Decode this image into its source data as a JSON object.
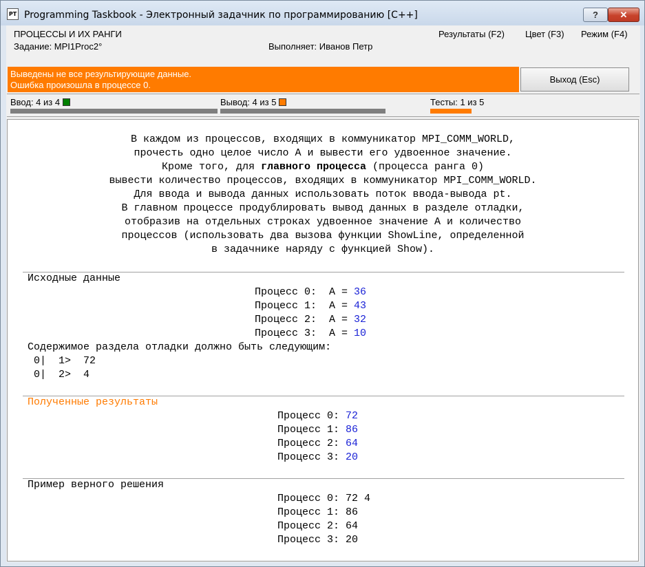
{
  "window": {
    "title": "Programming Taskbook - Электронный задачник по программированию [C++]",
    "app_icon_text": "PT",
    "help_label": "?",
    "close_label": "✕"
  },
  "header": {
    "group": "ПРОЦЕССЫ И ИХ РАНГИ",
    "task": "Задание: MPI1Proc2°",
    "performer": "Выполняет: Иванов Петр",
    "menu": {
      "results": "Результаты (F2)",
      "color": "Цвет (F3)",
      "mode": "Режим (F4)"
    }
  },
  "error": {
    "line1": "Выведены не все результирующие данные.",
    "line2": "Ошибка произошла в процессе 0."
  },
  "exit_button": "Выход (Esc)",
  "stats": {
    "input": "Ввод: 4 из 4",
    "output": "Вывод: 4 из 5",
    "tests": "Тесты: 1 из 5",
    "input_color": "#008000",
    "output_color": "#ff7b00"
  },
  "task": {
    "l1": "В каждом из процессов, входящих в коммуникатор MPI_COMM_WORLD,",
    "l2": "прочесть одно целое число A и вывести его удвоенное значение.",
    "l3_pre": "Кроме того, для ",
    "l3_bold": "главного процесса",
    "l3_post": " (процесса ранга 0)",
    "l4": "вывести количество процессов, входящих в коммуникатор MPI_COMM_WORLD.",
    "l5": "Для ввода и вывода данных использовать поток ввода-вывода pt.",
    "l6": "В главном процессе продублировать вывод данных в разделе отладки,",
    "l7": "отобразив на отдельных строках удвоенное значение A и количество",
    "l8": "процессов (использовать два вызова функции ShowLine, определенной",
    "l9": "в задачнике наряду с функцией Show)."
  },
  "input_section": {
    "title": "Исходные данные",
    "rows": [
      {
        "label": "Процесс 0:  A = ",
        "value": "36"
      },
      {
        "label": "Процесс 1:  A = ",
        "value": "43"
      },
      {
        "label": "Процесс 2:  A = ",
        "value": "32"
      },
      {
        "label": "Процесс 3:  A = ",
        "value": "10"
      }
    ],
    "debug_title": "Содержимое раздела отладки должно быть следующим:",
    "debug_lines": [
      " 0|  1>  72",
      " 0|  2>  4"
    ]
  },
  "results_section": {
    "title": "Полученные результаты",
    "rows": [
      {
        "label": "Процесс 0: ",
        "value": "72"
      },
      {
        "label": "Процесс 1: ",
        "value": "86"
      },
      {
        "label": "Процесс 2: ",
        "value": "64"
      },
      {
        "label": "Процесс 3: ",
        "value": "20"
      }
    ]
  },
  "example_section": {
    "title": "Пример верного решения",
    "rows": [
      "Процесс 0: 72 4",
      "Процесс 1: 86",
      "Процесс 2: 64",
      "Процесс 3: 20"
    ]
  }
}
